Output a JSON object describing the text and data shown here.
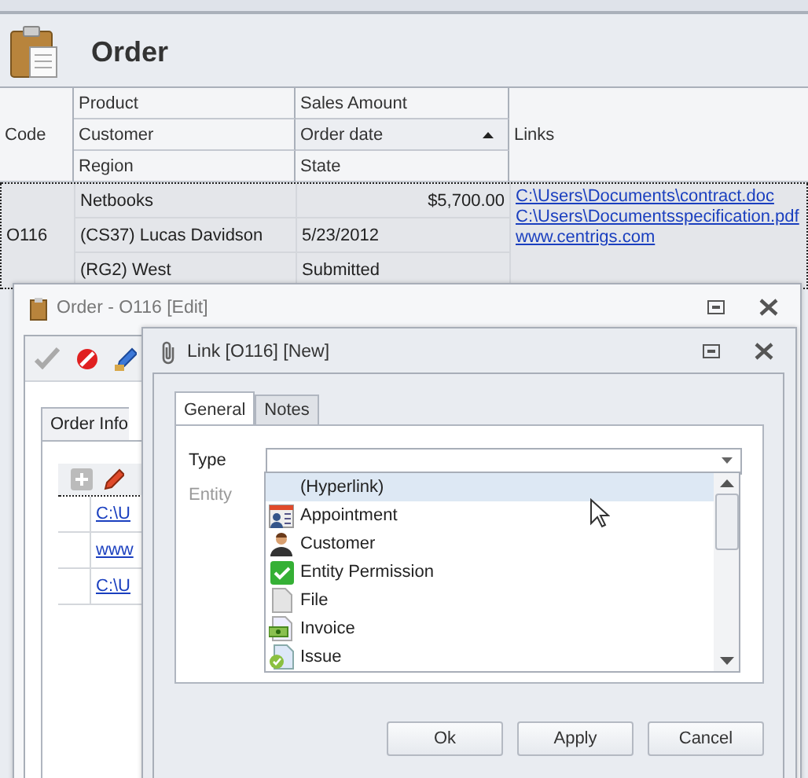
{
  "app_header": {
    "title": "Order"
  },
  "grid": {
    "code_column": "Code",
    "bands": [
      [
        {
          "label": "Product",
          "sorted": false
        },
        {
          "label": "Customer",
          "sorted": false
        },
        {
          "label": "Region",
          "sorted": false
        }
      ],
      [
        {
          "label": "Sales Amount",
          "sorted": false
        },
        {
          "label": "Order date",
          "sorted": true
        },
        {
          "label": "State",
          "sorted": false
        }
      ]
    ],
    "links_column": "Links",
    "rows": [
      {
        "selected": true,
        "code": "O116",
        "product": "Netbooks",
        "sales_amount": "$5,700.00",
        "customer": "(CS37) Lucas Davidson",
        "order_date": "5/23/2012",
        "region": "(RG2) West",
        "state": "Submitted",
        "links": [
          "C:\\Users\\Documents\\contract.doc",
          "C:\\Users\\Documentsspecification.pdf",
          "www.centrigs.com"
        ]
      }
    ]
  },
  "order_window": {
    "title": "Order - O116 [Edit]",
    "tabs": [
      {
        "label": "Order Info",
        "selected": true
      }
    ],
    "links": [
      "C:\\U",
      "www",
      "C:\\U"
    ]
  },
  "link_window": {
    "title": "Link [O116] [New]",
    "tabs": [
      {
        "label": "General",
        "selected": true
      },
      {
        "label": "Notes",
        "selected": false
      }
    ],
    "fields": [
      {
        "label": "Type",
        "disabled": false
      },
      {
        "label": "Entity",
        "disabled": true
      }
    ],
    "dropdown": [
      {
        "label": "(Hyperlink)",
        "kind": "none",
        "selected": true
      },
      {
        "label": "Appointment",
        "kind": "calendar",
        "selected": false
      },
      {
        "label": "Customer",
        "kind": "person",
        "selected": false
      },
      {
        "label": "Entity Permission",
        "kind": "check",
        "selected": false
      },
      {
        "label": "File",
        "kind": "file",
        "selected": false
      },
      {
        "label": "Invoice",
        "kind": "invoice",
        "selected": false
      },
      {
        "label": "Issue",
        "kind": "issue",
        "selected": false
      }
    ],
    "buttons": [
      "Ok",
      "Apply",
      "Cancel"
    ]
  }
}
